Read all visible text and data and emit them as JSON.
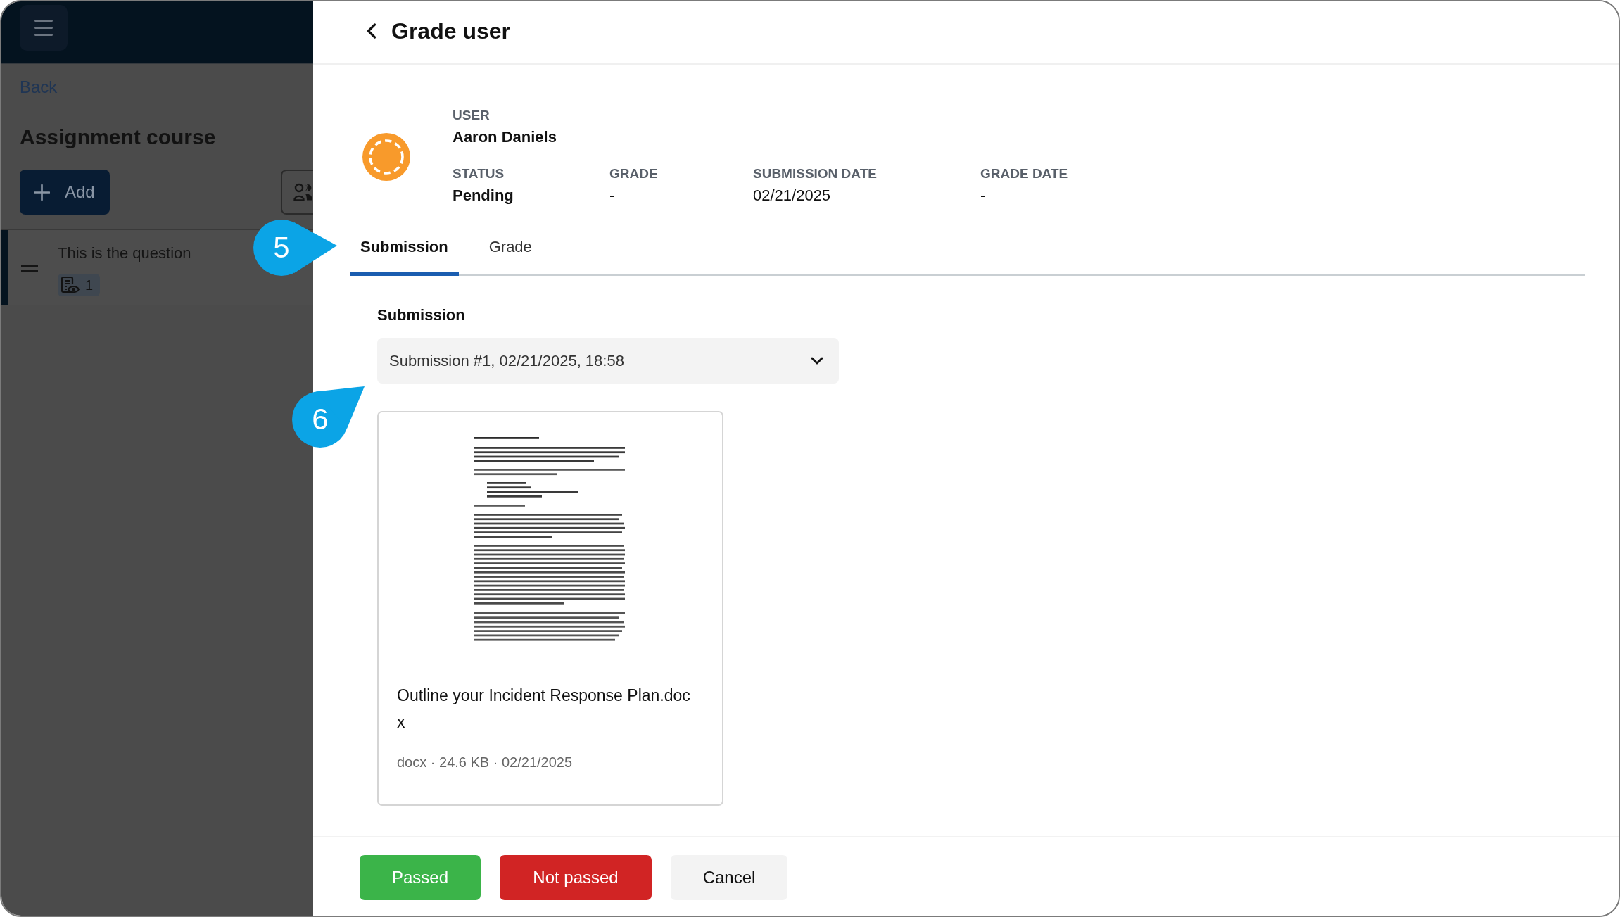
{
  "sidebar": {
    "back_link": "Back",
    "course_title": "Assignment course",
    "add_button": "Add",
    "items": [
      {
        "title": "This is the question",
        "view_count": "1",
        "selected": true
      }
    ]
  },
  "panel": {
    "title": "Grade user",
    "user_label": "USER",
    "user_name": "Aaron Daniels",
    "fields": [
      {
        "label": "STATUS",
        "value": "Pending",
        "kind": "status"
      },
      {
        "label": "GRADE",
        "value": "-",
        "kind": "text"
      },
      {
        "label": "SUBMISSION DATE",
        "value": "02/21/2025",
        "kind": "text"
      },
      {
        "label": "GRADE DATE",
        "value": "-",
        "kind": "text"
      }
    ],
    "tabs": [
      {
        "label": "Submission",
        "selected": true
      },
      {
        "label": "Grade",
        "selected": false
      }
    ],
    "submission": {
      "label": "Submission",
      "dropdown": "Submission #1, 02/21/2025, 18:58",
      "files": [
        {
          "name": "Outline your Incident Response Plan.docx",
          "meta": "docx · 24.6 KB · 02/21/2025"
        }
      ]
    },
    "buttons": [
      {
        "label": "Passed",
        "kind": "success"
      },
      {
        "label": "Not passed",
        "kind": "danger"
      },
      {
        "label": "Cancel",
        "kind": "neutral"
      }
    ]
  },
  "callouts": [
    {
      "number": "5",
      "kind": "pointer-right"
    },
    {
      "number": "6",
      "kind": "pointer-up-right"
    }
  ]
}
